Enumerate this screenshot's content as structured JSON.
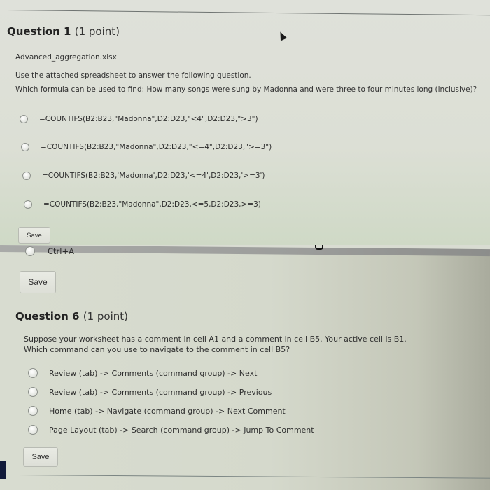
{
  "question1": {
    "title": "Question 1",
    "points": "(1 point)",
    "attachment": "Advanced_aggregation.xlsx",
    "instruction": "Use the attached spreadsheet to answer the following question.",
    "prompt": "Which formula can be used to find: How many songs were sung by Madonna and were three to four minutes long (inclusive)?",
    "options": [
      "=COUNTIFS(B2:B23,\"Madonna\",D2:D23,\"<4\",D2:D23,\">3\")",
      "=COUNTIFS(B2:B23,\"Madonna\",D2:D23,\"<=4\",D2:D23,\">=3\")",
      "=COUNTIFS(B2:B23,'Madonna',D2:D23,'<=4',D2:D23,'>=3')",
      "=COUNTIFS(B2:B23,\"Madonna\",D2:D23,<=5,D2:D23,>=3)"
    ],
    "save_label": "Save"
  },
  "previous_question": {
    "option": "Ctrl+A",
    "save_label": "Save"
  },
  "question6": {
    "title": "Question 6",
    "points": "(1 point)",
    "prompt_line1": "Suppose your worksheet has a comment in cell A1 and a comment in cell B5. Your active cell is B1.",
    "prompt_line2": "Which command can you use to navigate to the comment in cell B5?",
    "options": [
      "Review (tab) -> Comments (command group) -> Next",
      "Review (tab) -> Comments (command group) -> Previous",
      "Home (tab) -> Navigate (command group) -> Next Comment",
      "Page Layout (tab) -> Search (command group) -> Jump To Comment"
    ],
    "save_label": "Save"
  }
}
